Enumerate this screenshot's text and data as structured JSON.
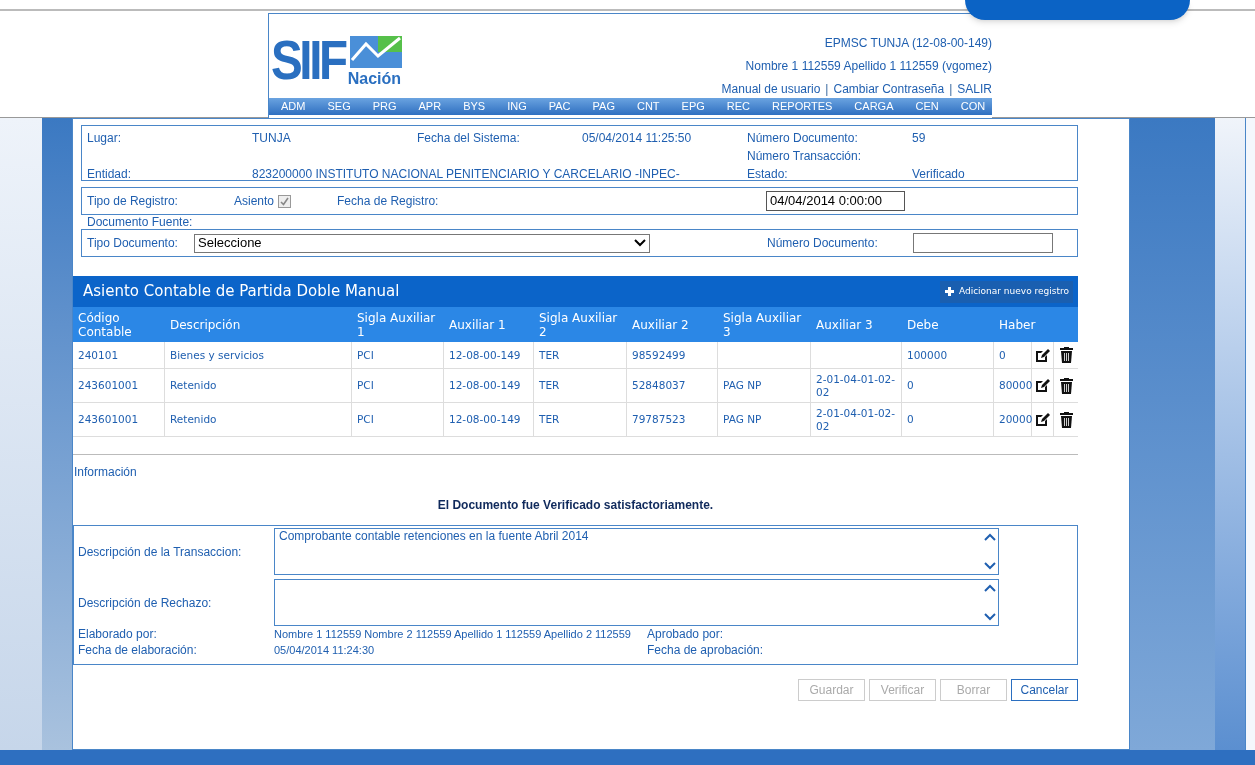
{
  "logo": {
    "name": "SIIF",
    "sub": "Nación"
  },
  "header": {
    "account": "EPMSC TUNJA (12-08-00-149)",
    "user": "Nombre 1 112559 Apellido 1 112559 (vgomez)",
    "links": [
      {
        "kind": "link",
        "label": "Manual de usuario"
      },
      {
        "kind": "separator",
        "label": "|"
      },
      {
        "kind": "link",
        "label": "Cambiar Contraseña"
      },
      {
        "kind": "separator",
        "label": "|"
      },
      {
        "kind": "link",
        "label": "SALIR"
      }
    ]
  },
  "menu": [
    "ADM",
    "SEG",
    "PRG",
    "APR",
    "BYS",
    "ING",
    "PAC",
    "PAG",
    "CNT",
    "EPG",
    "REC",
    "REPORTES",
    "CARGA",
    "CEN",
    "CON"
  ],
  "info": {
    "rows": [
      [
        {
          "kind": "label",
          "text": "Lugar:"
        },
        {
          "kind": "value",
          "text": "TUNJA"
        },
        {
          "kind": "label",
          "text": "Fecha del Sistema:"
        },
        {
          "kind": "value",
          "text": "05/04/2014 11:25:50"
        },
        {
          "kind": "label",
          "text": "Número Documento:"
        },
        {
          "kind": "value",
          "text": "59"
        }
      ],
      [
        {
          "kind": "empty"
        },
        {
          "kind": "empty"
        },
        {
          "kind": "empty"
        },
        {
          "kind": "empty"
        },
        {
          "kind": "label",
          "text": "Número Transacción:"
        },
        {
          "kind": "empty"
        }
      ],
      [
        {
          "kind": "label",
          "text": "Entidad:"
        },
        {
          "kind": "value",
          "text": "823200000 INSTITUTO NACIONAL PENITENCIARIO Y CARCELARIO -INPEC-"
        },
        {
          "kind": "empty"
        },
        {
          "kind": "empty"
        },
        {
          "kind": "label",
          "text": "Estado:"
        },
        {
          "kind": "value",
          "text": "Verificado"
        }
      ]
    ]
  },
  "registro": {
    "label": "Tipo de Registro:",
    "option": "Asiento",
    "checked": true,
    "date_label": "Fecha de Registro:",
    "date_value": "04/04/2014 0:00:00"
  },
  "fuente": {
    "title": "Documento Fuente:",
    "type_label": "Tipo Documento:",
    "type_value": "Seleccione",
    "number_label": "Número Documento:"
  },
  "table": {
    "title": "Asiento Contable de Partida Doble Manual",
    "add_button": "Adicionar nuevo registro",
    "columns": [
      "Código Contable",
      "Descripción",
      "Sigla Auxiliar 1",
      "Auxiliar 1",
      "Sigla Auxiliar 2",
      "Auxiliar 2",
      "Sigla Auxiliar 3",
      "Auxiliar 3",
      "Debe",
      "Haber"
    ],
    "rows": [
      [
        "240101",
        "Bienes y servicios",
        "PCI",
        "12-08-00-149",
        "TER",
        "98592499",
        "",
        "",
        "100000",
        "0"
      ],
      [
        "243601001",
        "Retenido",
        "PCI",
        "12-08-00-149",
        "TER",
        "52848037",
        "PAG NP",
        "2-01-04-01-02-02",
        "0",
        "80000"
      ],
      [
        "243601001",
        "Retenido",
        "PCI",
        "12-08-00-149",
        "TER",
        "79787523",
        "PAG NP",
        "2-01-04-01-02-02",
        "0",
        "20000"
      ]
    ]
  },
  "information": {
    "title": "Información",
    "message": "El Documento fue Verificado satisfactoriamente.",
    "transaction_label": "Descripción de la Transaccion:",
    "transaction_value": "Comprobante contable retenciones en la fuente Abril 2014",
    "rejection_label": "Descripción de Rechazo:",
    "details": [
      {
        "label": "Elaborado por:",
        "value": "Nombre 1 112559 Nombre 2 112559 Apellido 1 112559 Apellido 2 112559",
        "label2": "Aprobado por:"
      },
      {
        "label": "Fecha de elaboración:",
        "value": "05/04/2014 11:24:30",
        "label2": "Fecha de aprobación:"
      }
    ]
  },
  "buttons": [
    {
      "label": "Guardar",
      "disabled": true
    },
    {
      "label": "Verificar",
      "disabled": true
    },
    {
      "label": "Borrar",
      "disabled": true
    },
    {
      "label": "Cancelar",
      "disabled": false
    }
  ]
}
